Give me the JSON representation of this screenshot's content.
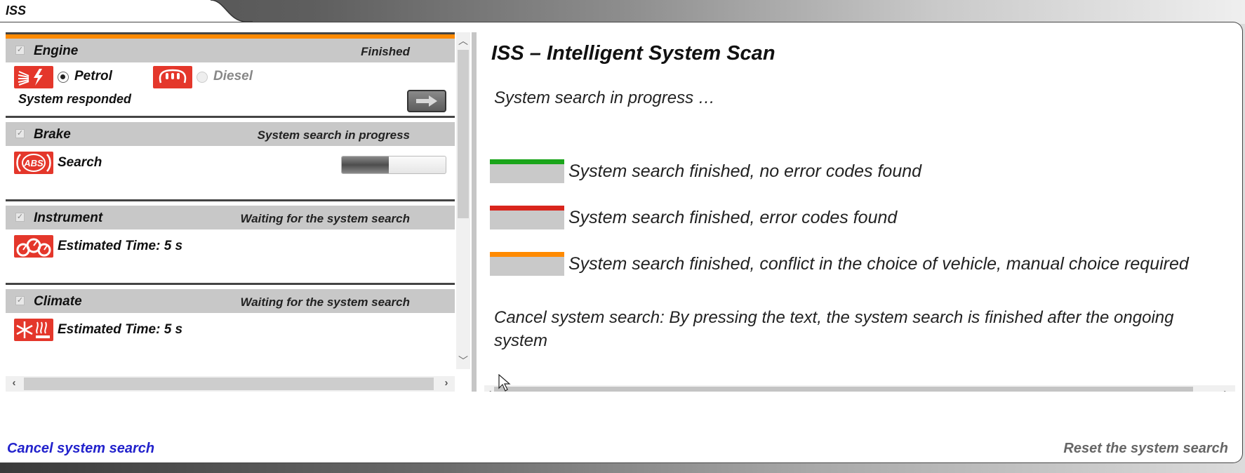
{
  "app": {
    "tab_title": "ISS"
  },
  "systems": [
    {
      "name": "Engine",
      "status": "Finished",
      "checked": true,
      "icon": "engine-glow-plug-icon",
      "fuel_options": [
        {
          "label": "Petrol",
          "selected": true,
          "icon": "petrol-injection-icon"
        },
        {
          "label": "Diesel",
          "selected": false,
          "icon": "diesel-glow-plug-icon"
        }
      ],
      "body_text": "System responded",
      "action": "arrow-right"
    },
    {
      "name": "Brake",
      "status": "System search in progress",
      "checked": true,
      "icon": "abs-icon",
      "icon_text": "ABS",
      "body_text": "Search",
      "progress_percent": 45
    },
    {
      "name": "Instrument",
      "status": "Waiting for the system search",
      "checked": true,
      "icon": "instrument-cluster-icon",
      "body_text": "Estimated Time: 5 s"
    },
    {
      "name": "Climate",
      "status": "Waiting for the system search",
      "checked": true,
      "icon": "climate-icon",
      "body_text": "Estimated Time: 5 s"
    }
  ],
  "info": {
    "title": "ISS – Intelligent System Scan",
    "progress_text": "System search in progress …",
    "legend": [
      {
        "color": "#1aa51a",
        "text": "System search finished, no error codes found"
      },
      {
        "color": "#d9251c",
        "text": "System search finished, error codes found"
      },
      {
        "color": "#ff8a00",
        "text": "System search finished, conflict in the choice of vehicle, manual choice required"
      }
    ],
    "cancel_info": "Cancel system search: By pressing the text, the system search is finished after the ongoing system"
  },
  "footer": {
    "cancel_label": "Cancel system search",
    "reset_label": "Reset the system search"
  },
  "colors": {
    "accent_orange": "#ff8a00",
    "icon_red": "#e4372b",
    "link_blue": "#2222cc"
  }
}
